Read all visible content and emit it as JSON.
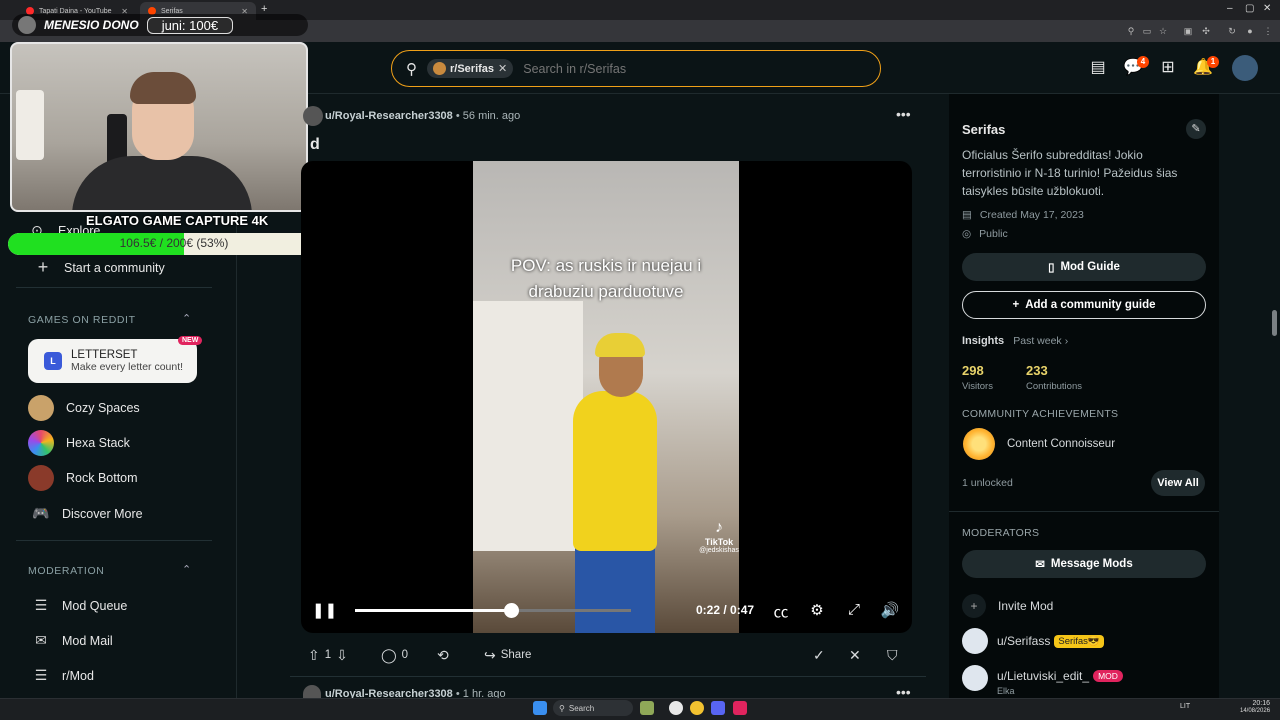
{
  "browser": {
    "tabs": [
      {
        "title": "Tapati Daina - YouTube"
      },
      {
        "title": "Serifas"
      }
    ]
  },
  "stream_overlay": {
    "donation_label": "MENESIO DONO",
    "donation_amount": "juni: 100€",
    "camera_label": "ELGATO GAME CAPTURE 4K",
    "goal_text": "106.5€ / 200€ (53%)",
    "goal_progress": 0.53
  },
  "header": {
    "search": {
      "chip": "r/Serifas",
      "placeholder": "Search in r/Serifas"
    },
    "chat_badge": "4",
    "notif_badge": "1"
  },
  "sidebar": {
    "explore": "Explore",
    "start_community": "Start a community",
    "games_heading": "GAMES ON REDDIT",
    "letterset": {
      "title": "LETTERSET",
      "subtitle": "Make every letter count!",
      "badge": "NEW",
      "icon": "L"
    },
    "games": [
      {
        "label": "Cozy Spaces",
        "color": "#c9a26a"
      },
      {
        "label": "Hexa Stack",
        "color": "#e84a6a"
      },
      {
        "label": "Rock Bottom",
        "color": "#8a3a2a"
      }
    ],
    "discover_more": "Discover More",
    "moderation_heading": "MODERATION",
    "moderation_items": [
      {
        "label": "Mod Queue",
        "icon": "queue-icon"
      },
      {
        "label": "Mod Mail",
        "icon": "mail-icon"
      },
      {
        "label": "r/Mod",
        "icon": "mod-list-icon"
      }
    ]
  },
  "post": {
    "author": "u/Royal-Researcher3308",
    "time": "56 min. ago",
    "title_fragment": "d",
    "video": {
      "caption_line1": "POV: as ruskis ir nuejau i",
      "caption_line2": "drabuziu parduotuve",
      "watermark": "TikTok",
      "watermark_handle": "@jedskishas",
      "time": "0:22 / 0:47",
      "progress": 0.468
    },
    "votes": "1",
    "comments": "0",
    "share": "Share"
  },
  "next_post": {
    "author": "u/Royal-Researcher3308",
    "time": "1 hr. ago"
  },
  "community": {
    "name": "Serifas",
    "description": "Oficialus Šerifo subredditas! Jokio terroristinio ir N-18 turinio! Pažeidus šias taisykles būsite užblokuoti.",
    "created": "Created May 17, 2023",
    "visibility": "Public",
    "mod_guide": "Mod Guide",
    "add_guide": "Add a community guide",
    "insights_label": "Insights",
    "insights_period": "Past week",
    "visitors_value": "298",
    "visitors_label": "Visitors",
    "contributions_value": "233",
    "contributions_label": "Contributions",
    "achievements_heading": "COMMUNITY ACHIEVEMENTS",
    "achievement": "Content Connoisseur",
    "unlocked": "1 unlocked",
    "view_all": "View All",
    "moderators_heading": "MODERATORS",
    "message_mods": "Message Mods",
    "invite_mod": "Invite Mod",
    "mods": [
      {
        "name": "u/Serifass",
        "flair": "Serifas😎",
        "flair_color": "#f5c518"
      },
      {
        "name": "u/Lietuviski_edit_",
        "flair": "MOD",
        "flair_color": "#e0245e",
        "sub": "Elka"
      }
    ]
  },
  "taskbar": {
    "search": "Search",
    "lang": "LIT",
    "time": "20:16",
    "date": "14/08/2026"
  }
}
